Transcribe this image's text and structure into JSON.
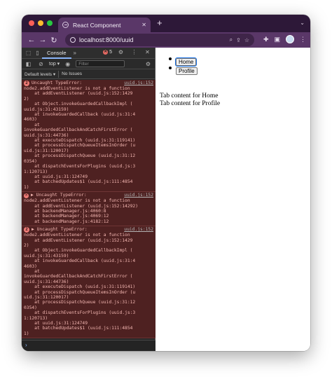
{
  "window": {
    "tab_title": "React Component",
    "url": "localhost:8000/uuid",
    "colors": {
      "titlebar": "#2d1838",
      "toolbar": "#5a3768",
      "close": "#ff5f57",
      "minimize": "#febc2e",
      "zoom": "#28c840"
    }
  },
  "devtools": {
    "active_tab": "Console",
    "error_count": "5",
    "context": "top",
    "filter_placeholder": "Filter",
    "levels": "Default levels",
    "issues": "No Issues",
    "entries": [
      {
        "count": "2",
        "source": "uuid.js:152",
        "lines": [
          "Uncaught TypeError:",
          "node2.addEventListener is not a function",
          "    at addEventListener (uuid.js:152:1429",
          "2)",
          "    at Object.invokeGuardedCallbackImpl (",
          "uuid.js:31:43159)",
          "    at invokeGuardedCallback (uuid.js:31:4",
          "4603)",
          "    at",
          "invokeGuardedCallbackAndCatchFirstError (",
          "uuid.js:31:44736)",
          "    at executeDispatch (uuid.js:31:119141)",
          "    at processDispatchQueueItemsInOrder (u",
          "uid.js:31:120017)",
          "    at processDispatchQueue (uuid.js:31:12",
          "0354)",
          "    at dispatchEventsForPlugins (uuid.js:3",
          "1:120713)",
          "    at uuid.js:31:124749",
          "    at batchedUpdates$1 (uuid.js:111:4854",
          "1)"
        ]
      },
      {
        "count": "",
        "source": "uuid.js:152",
        "lines": [
          "▶ Uncaught TypeError:",
          "node2.addEventListener is not a function",
          "    at addEventListener (uuid.js:152:14292)",
          "    at backendManager.js:4060:8",
          "    at backendManager.js:4069:12",
          "    at backendManager.js:4182:12"
        ]
      },
      {
        "count": "2",
        "source": "uuid.js:152",
        "lines": [
          "▶ Uncaught TypeError:",
          "node2.addEventListener is not a function",
          "    at addEventListener (uuid.js:152:1429",
          "2)",
          "    at Object.invokeGuardedCallbackImpl (",
          "uuid.js:31:43159)",
          "    at invokeGuardedCallback (uuid.js:31:4",
          "4603)",
          "    at",
          "invokeGuardedCallbackAndCatchFirstError (",
          "uuid.js:31:44736)",
          "    at executeDispatch (uuid.js:31:119141)",
          "    at processDispatchQueueItemsInOrder (u",
          "uid.js:31:120017)",
          "    at processDispatchQueue (uuid.js:31:12",
          "0354)",
          "    at dispatchEventsForPlugins (uuid.js:3",
          "1:120713)",
          "    at uuid.js:31:124749",
          "    at batchedUpdates$1 (uuid.js:111:4854",
          "1)"
        ]
      }
    ]
  },
  "page": {
    "buttons": [
      {
        "label": "Home"
      },
      {
        "label": "Profile"
      }
    ],
    "content": [
      "Tab content for Home",
      "Tab content for Profile"
    ]
  }
}
